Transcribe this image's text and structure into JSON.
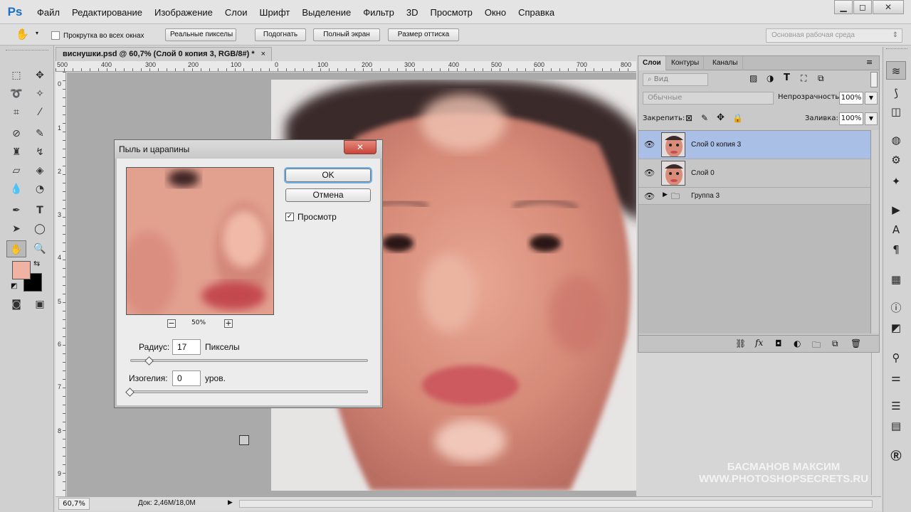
{
  "app": {
    "logo": "Ps"
  },
  "menu": [
    "Файл",
    "Редактирование",
    "Изображение",
    "Слои",
    "Шрифт",
    "Выделение",
    "Фильтр",
    "3D",
    "Просмотр",
    "Окно",
    "Справка"
  ],
  "window_controls": {
    "minimize": "▁",
    "restore": "◻",
    "close": "✕"
  },
  "options_bar": {
    "hand_tool_icon": "hand-icon",
    "scroll_all": "Прокрутка во всех окнах",
    "buttons": [
      "Реальные пикселы",
      "Подогнать",
      "Полный экран",
      "Размер оттиска"
    ],
    "workspace": "Основная рабочая среда"
  },
  "document": {
    "tab_title": "виснушки.psd @ 60,7% (Слой 0 копия 3, RGB/8#) *",
    "close": "×",
    "ruler_h": [
      "500",
      "400",
      "300",
      "200",
      "100",
      "0",
      "100",
      "200",
      "300",
      "400",
      "500",
      "600",
      "700",
      "800"
    ],
    "ruler_v": [
      "0",
      "1",
      "2",
      "3",
      "4",
      "5",
      "6",
      "7",
      "8",
      "9"
    ],
    "zoom": "60,7%",
    "doc_info": "Док: 2,46M/18,0M",
    "status_arrow": "▶"
  },
  "dialog": {
    "title": "Пыль и царапины",
    "close": "✕",
    "ok": "OK",
    "cancel": "Отмена",
    "preview_label": "Просмотр",
    "preview_checked": "✓",
    "zoom_out": "−",
    "zoom_in": "+",
    "preview_zoom": "50%",
    "radius_label": "Радиус:",
    "radius_value": "17",
    "radius_unit": "Пикселы",
    "threshold_label": "Изогелия:",
    "threshold_value": "0",
    "threshold_unit": "уров."
  },
  "layers_panel": {
    "tabs": [
      "Слои",
      "Контуры",
      "Каналы"
    ],
    "kind_filter": "Вид",
    "blend_mode": "Обычные",
    "opacity_label": "Непрозрачность:",
    "opacity": "100%",
    "lock_label": "Закрепить:",
    "fill_label": "Заливка:",
    "fill": "100%",
    "layers": [
      {
        "name": "Слой 0 копия 3",
        "selected": true
      },
      {
        "name": "Слой 0",
        "selected": false
      },
      {
        "name": "Группа 3",
        "selected": false
      }
    ],
    "footer_icons": [
      "link-icon",
      "fx-icon",
      "mask-icon",
      "adjustment-icon",
      "folder-icon",
      "new-layer-icon",
      "trash-icon"
    ]
  },
  "watermark": {
    "line1": "БАСМАНОВ МАКСИМ",
    "line2": "WWW.PHOTOSHOPSECRETS.RU"
  },
  "colors": {
    "foreground": "#f0b3a3",
    "background": "#000000",
    "selected_layer": "#a9bfe6",
    "accent": "#1b6fc7"
  }
}
